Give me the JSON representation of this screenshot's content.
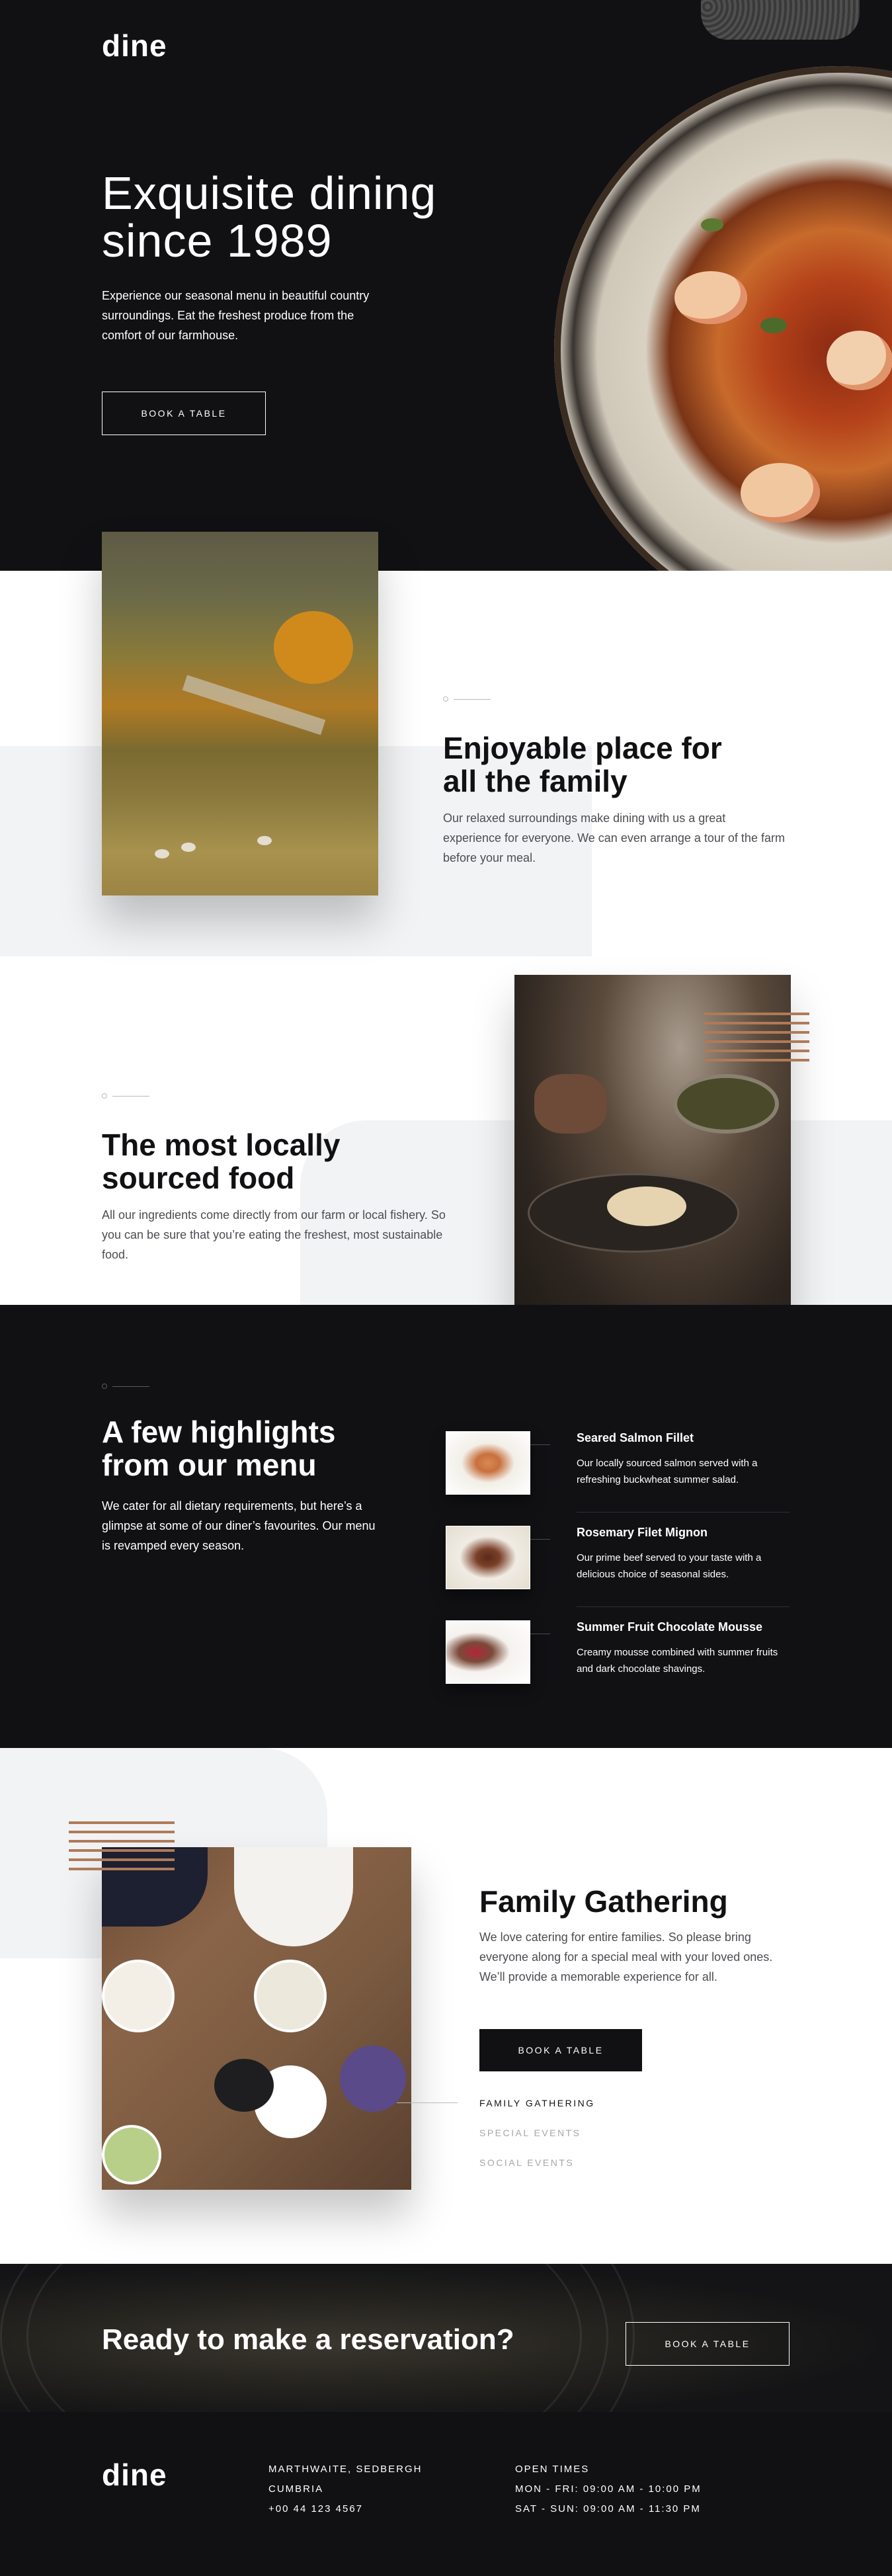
{
  "brand": {
    "logo_text": "dine"
  },
  "hero": {
    "title": "Exquisite dining since 1989",
    "description": "Experience our seasonal menu in beautiful country surroundings. Eat the freshest produce from the comfort of our farmhouse.",
    "button_label": "BOOK A TABLE"
  },
  "features": [
    {
      "title": "Enjoyable place for all the family",
      "description": "Our relaxed surroundings make dining with us a great experience for everyone. We can even arrange a tour of the farm before your meal."
    },
    {
      "title": "The most locally sourced food",
      "description": "All our ingredients come directly from our farm or local fishery. So you can be sure that you’re eating the freshest, most sustainable food."
    }
  ],
  "highlights": {
    "title": "A few highlights from our menu",
    "description": "We cater for all dietary requirements, but here’s a glimpse at some of our diner’s favourites. Our menu is revamped every season.",
    "items": [
      {
        "name": "Seared Salmon Fillet",
        "description": "Our locally sourced salmon served with a refreshing buckwheat summer salad."
      },
      {
        "name": "Rosemary Filet Mignon",
        "description": "Our prime beef served to your taste with a delicious choice of seasonal sides."
      },
      {
        "name": "Summer Fruit Chocolate Mousse",
        "description": "Creamy mousse combined with summer fruits and dark chocolate shavings."
      }
    ]
  },
  "events": {
    "title": "Family Gathering",
    "description": "We love catering for entire families. So please bring everyone along for a special meal with your loved ones. We’ll provide a memorable experience for all.",
    "button_label": "BOOK A TABLE",
    "tabs": [
      {
        "label": "FAMILY GATHERING",
        "active": true
      },
      {
        "label": "SPECIAL EVENTS",
        "active": false
      },
      {
        "label": "SOCIAL EVENTS",
        "active": false
      }
    ]
  },
  "reservation": {
    "title": "Ready to make a reservation?",
    "button_label": "BOOK A TABLE"
  },
  "footer": {
    "logo_text": "dine",
    "address": [
      "MARTHWAITE, SEDBERGH",
      "CUMBRIA",
      "+00 44 123 4567"
    ],
    "hours": [
      "OPEN TIMES",
      "MON - FRI: 09:00 AM - 10:00 PM",
      "SAT - SUN: 09:00 AM - 11:30 PM"
    ]
  },
  "colors": {
    "dark": "#111114",
    "light_grey": "#f2f3f5",
    "accent_stripes": "#b07a58",
    "muted_text": "#4c4d52",
    "inactive_tab": "#a4a6ac"
  }
}
